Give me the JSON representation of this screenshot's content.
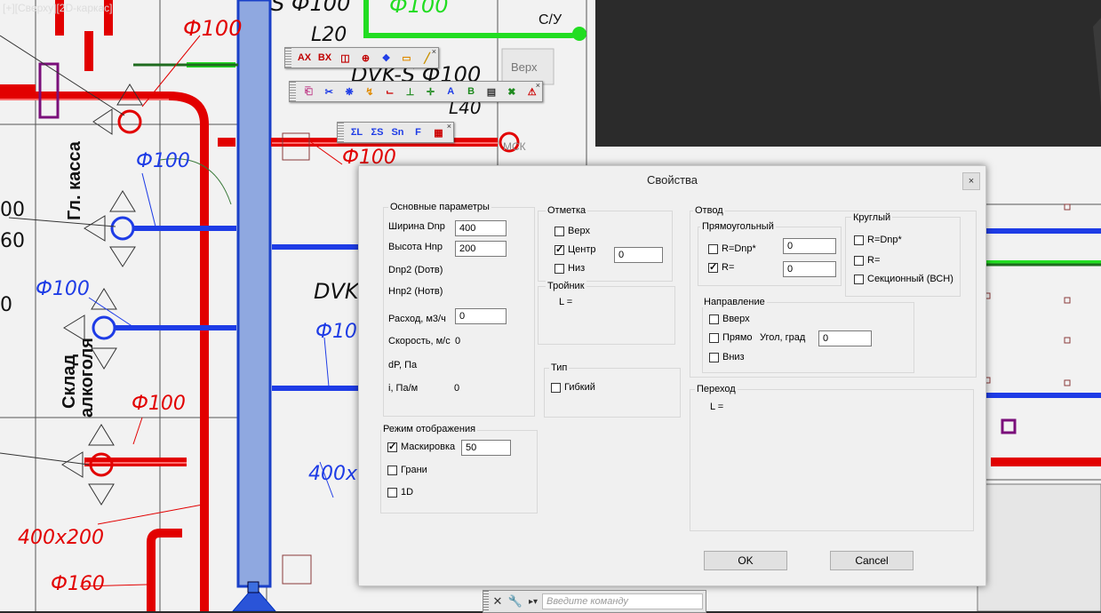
{
  "viewport": {
    "label": "[+][Сверху][2D-каркас]",
    "cad_labels": {
      "d100_a": "Ф100",
      "d100_b": "Ф100",
      "d100_c": "Ф100",
      "d100_d": "Ф100",
      "d100_e": "Ф100",
      "d100_f": "Ф100",
      "d100_g": "Ф100",
      "d100_h": "Ф100",
      "s100": "S Ф100",
      "l20": "L20",
      "dvk_s100": "DVK-S Ф100",
      "l40": "L40",
      "dvk": "DVK",
      "size_400x": "400x",
      "size_400x200": "400x200",
      "d160": "Ф160",
      "room_kassa": "Гл. касса",
      "room_sklad_1": "Склад",
      "room_sklad_2": "алкоголя",
      "cy": "С/У",
      "verh_tag": "Верх",
      "mck_tag": "МСК",
      "edge_00": "00",
      "edge_60": "60",
      "edge_0": "0"
    }
  },
  "toolbars": {
    "tb1": [
      "AX",
      "BX",
      "копия",
      "узел",
      "сеть",
      "рамка",
      "штрих"
    ],
    "tb2": [
      "ластик",
      "ножницы",
      "вентилятор",
      "отвод",
      "тройник",
      "крест",
      "A+",
      "BM",
      "лист",
      "удалить",
      "внимание"
    ],
    "tb3": [
      "ΣL",
      "ΣS",
      "Sn",
      "F",
      "таблица"
    ]
  },
  "dialog": {
    "title": "Свойства",
    "close": "×",
    "main": {
      "title": "Основные параметры",
      "width_label": "Ширина Dnp",
      "width_value": "400",
      "height_label": "Высота Hnp",
      "height_value": "200",
      "dnp2_label": "Dnp2 (Dотв)",
      "hnp2_label": "Hnp2 (Hотв)",
      "flow_label": "Расход, м3/ч",
      "flow_value": "0",
      "speed_label": "Скорость, м/с",
      "speed_value": "0",
      "dp_label": "dP,  Па",
      "i_label": "i,  Па/м",
      "i_value": "0"
    },
    "elevation": {
      "title": "Отметка",
      "top": "Верх",
      "center": "Центр",
      "bottom": "Низ",
      "value": "0",
      "checked": "Центр"
    },
    "tee": {
      "title": "Тройник",
      "l_label": "L ="
    },
    "type": {
      "title": "Тип",
      "flexible": "Гибкий"
    },
    "display": {
      "title": "Режим отображения",
      "mask": "Маскировка",
      "mask_value": "50",
      "edges": "Грани",
      "one_d": "1D"
    },
    "bend": {
      "title": "Отвод",
      "rect_title": "Прямоугольный",
      "r_dnp": "R=Dnp*",
      "r_dnp_value": "0",
      "r": "R=",
      "r_value": "0",
      "round_title": "Круглый",
      "round_r_dnp": "R=Dnp*",
      "round_r": "R=",
      "round_sectional": "Секционный (ВСН)",
      "dir_title": "Направление",
      "dir_up": "Вверх",
      "dir_straight": "Прямо",
      "dir_down": "Вниз",
      "angle_label": "Угол, град",
      "angle_value": "0"
    },
    "transition": {
      "title": "Переход",
      "l_label": "L ="
    },
    "ok": "OK",
    "cancel": "Cancel"
  },
  "cmdline": {
    "placeholder": "Введите команду"
  }
}
